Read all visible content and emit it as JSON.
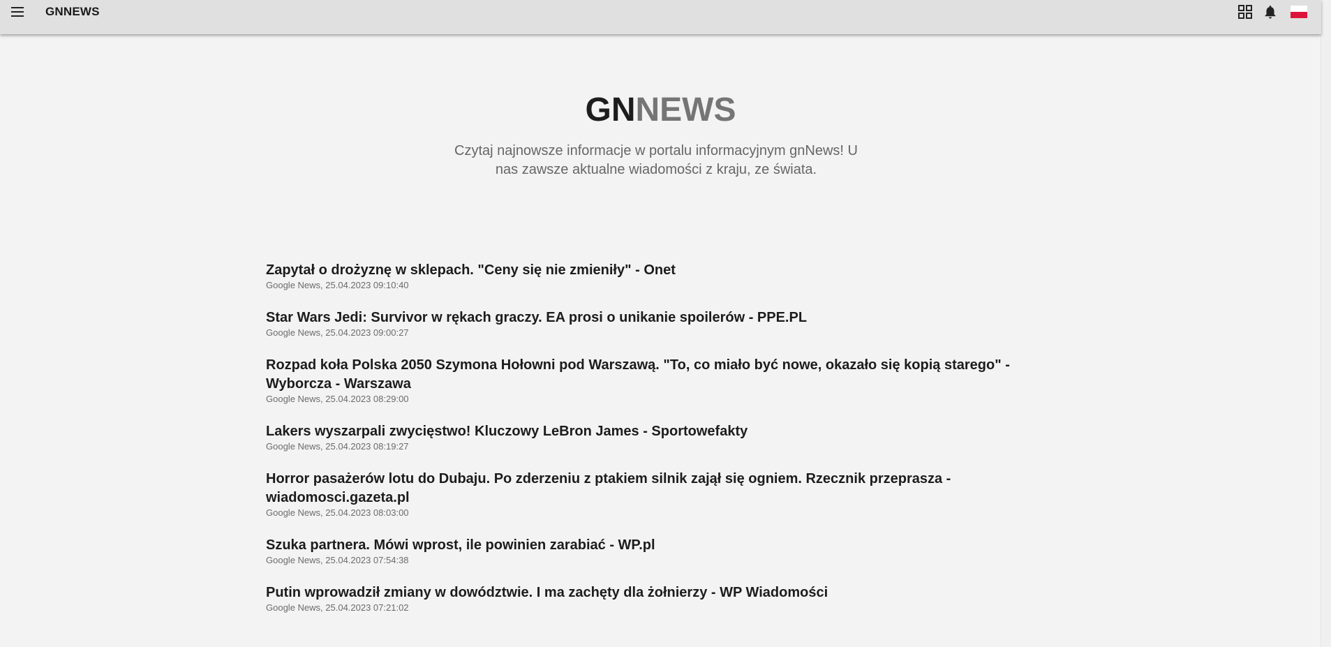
{
  "header": {
    "brand": "GNNEWS",
    "icons": {
      "menu": "hamburger-menu-icon",
      "apps": "grid-apps-icon",
      "notifications": "bell-icon",
      "language": "poland-flag-icon"
    }
  },
  "hero": {
    "title_part1": "GN",
    "title_part2": "NEWS",
    "subtitle": "Czytaj najnowsze informacje w portalu informacyjnym gnNews! U nas zawsze aktualne wiadomości z kraju, ze świata."
  },
  "articles": [
    {
      "title": "Zapytał o drożyznę w sklepach. \"Ceny się nie zmieniły\" - Onet",
      "meta": "Google News, 25.04.2023 09:10:40"
    },
    {
      "title": "Star Wars Jedi: Survivor w rękach graczy. EA prosi o unikanie spoilerów - PPE.PL",
      "meta": "Google News, 25.04.2023 09:00:27"
    },
    {
      "title": "Rozpad koła Polska 2050 Szymona Hołowni pod Warszawą. \"To, co miało być nowe, okazało się kopią starego\" - Wyborcza - Warszawa",
      "meta": "Google News, 25.04.2023 08:29:00"
    },
    {
      "title": "Lakers wyszarpali zwycięstwo! Kluczowy LeBron James - Sportowefakty",
      "meta": "Google News, 25.04.2023 08:19:27"
    },
    {
      "title": "Horror pasażerów lotu do Dubaju. Po zderzeniu z ptakiem silnik zajął się ogniem. Rzecznik przeprasza - wiadomosci.gazeta.pl",
      "meta": "Google News, 25.04.2023 08:03:00"
    },
    {
      "title": "Szuka partnera. Mówi wprost, ile powinien zarabiać - WP.pl",
      "meta": "Google News, 25.04.2023 07:54:38"
    },
    {
      "title": "Putin wprowadził zmiany w dowództwie. I ma zachęty dla żołnierzy - WP Wiadomości",
      "meta": "Google News, 25.04.2023 07:21:02"
    }
  ],
  "colors": {
    "topbar": "#e0e0e0",
    "background": "#f3f3f3",
    "title_dark": "#1d1d1d",
    "title_grey": "#757575",
    "flag_red": "#dc143c"
  }
}
